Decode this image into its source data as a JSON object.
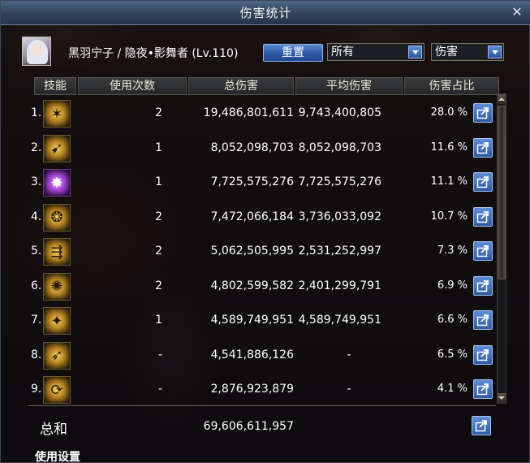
{
  "window": {
    "title": "伤害统计"
  },
  "character": {
    "name": "黑羽宁子 / 隐夜•影舞者 (Lv.110)"
  },
  "controls": {
    "reset_label": "重置",
    "filter_selected": "所有",
    "metric_selected": "伤害"
  },
  "columns": {
    "skill": "技能",
    "uses": "使用次数",
    "total": "总伤害",
    "avg": "平均伤害",
    "pct": "伤害占比"
  },
  "rows": [
    {
      "rank": "1.",
      "icon": "claw-slash-icon",
      "uses": "2",
      "total": "19,486,801,611",
      "avg": "9,743,400,805",
      "pct": "28.0 %"
    },
    {
      "rank": "2.",
      "icon": "blade-sweep-icon",
      "uses": "1",
      "total": "8,052,098,703",
      "avg": "8,052,098,703",
      "pct": "11.6 %"
    },
    {
      "rank": "3.",
      "icon": "shadow-burst-icon",
      "uses": "1",
      "total": "7,725,575,276",
      "avg": "7,725,575,276",
      "pct": "11.1 %"
    },
    {
      "rank": "4.",
      "icon": "spin-strike-icon",
      "uses": "2",
      "total": "7,472,066,184",
      "avg": "3,736,033,092",
      "pct": "10.7 %"
    },
    {
      "rank": "5.",
      "icon": "dagger-throw-icon",
      "uses": "2",
      "total": "5,062,505,995",
      "avg": "2,531,252,997",
      "pct": "7.3 %"
    },
    {
      "rank": "6.",
      "icon": "star-flash-icon",
      "uses": "2",
      "total": "4,802,599,582",
      "avg": "2,401,299,791",
      "pct": "6.9 %"
    },
    {
      "rank": "7.",
      "icon": "wing-dance-icon",
      "uses": "1",
      "total": "4,589,749,951",
      "avg": "4,589,749,951",
      "pct": "6.6 %"
    },
    {
      "rank": "8.",
      "icon": "dash-kick-icon",
      "uses": "-",
      "total": "4,541,886,126",
      "avg": "-",
      "pct": "6.5 %"
    },
    {
      "rank": "9.",
      "icon": "whirl-arrow-icon",
      "uses": "-",
      "total": "2,876,923,879",
      "avg": "-",
      "pct": "4.1 %"
    }
  ],
  "summary": {
    "label": "总和",
    "total": "69,606,611,957"
  },
  "footer": {
    "settings_label": "使用设置"
  },
  "colors": {
    "titlebar": "#33465f",
    "button_blue": "#2f5aa8",
    "panel_bg": "#0a0a0e"
  }
}
